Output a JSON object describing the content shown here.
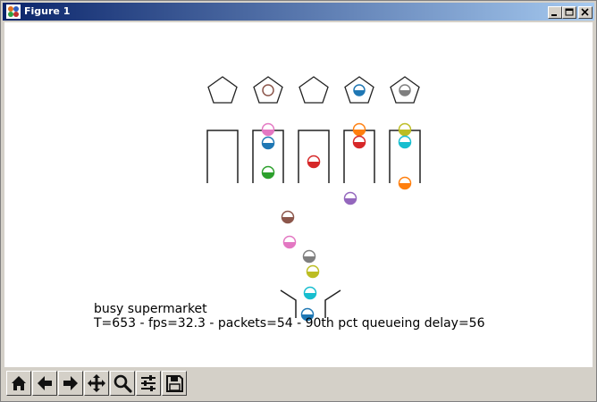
{
  "window": {
    "title": "Figure 1"
  },
  "figure": {
    "line1": "busy supermarket",
    "line2": "T=653 - fps=32.3 - packets=54 - 90th pct queueing delay=56"
  },
  "colors": {
    "blue": "#1f77b4",
    "orange": "#ff7f0e",
    "green": "#2ca02c",
    "red": "#d62728",
    "purple": "#9467bd",
    "brown": "#8c564b",
    "pink": "#e377c2",
    "gray": "#7f7f7f",
    "olive": "#bcbd22",
    "cyan": "#17becf"
  },
  "scene": {
    "servers": [
      {
        "name": "server-1",
        "holding": null
      },
      {
        "name": "server-2",
        "holding": "brown"
      },
      {
        "name": "server-3",
        "holding": null
      },
      {
        "name": "server-4",
        "holding": "blue"
      },
      {
        "name": "server-5",
        "holding": "gray"
      }
    ],
    "packets": [
      {
        "color": "pink",
        "where": "queue-2"
      },
      {
        "color": "blue",
        "where": "queue-2"
      },
      {
        "color": "green",
        "where": "queue-2"
      },
      {
        "color": "red",
        "where": "queue-3"
      },
      {
        "color": "orange",
        "where": "queue-4"
      },
      {
        "color": "red",
        "where": "queue-4"
      },
      {
        "color": "olive",
        "where": "queue-5"
      },
      {
        "color": "cyan",
        "where": "queue-5"
      },
      {
        "color": "orange",
        "where": "queue-5"
      },
      {
        "color": "purple",
        "where": "in-flight"
      },
      {
        "color": "brown",
        "where": "in-flight"
      },
      {
        "color": "pink",
        "where": "in-flight"
      },
      {
        "color": "gray",
        "where": "in-flight"
      },
      {
        "color": "olive",
        "where": "in-flight"
      },
      {
        "color": "cyan",
        "where": "in-flight"
      },
      {
        "color": "blue",
        "where": "entrance"
      }
    ]
  },
  "toolbar": {
    "buttons": [
      {
        "name": "home-button",
        "icon": "home-icon"
      },
      {
        "name": "back-button",
        "icon": "arrow-left-icon"
      },
      {
        "name": "forward-button",
        "icon": "arrow-right-icon"
      },
      {
        "name": "pan-button",
        "icon": "move-icon"
      },
      {
        "name": "zoom-button",
        "icon": "magnifier-icon"
      },
      {
        "name": "configure-subplots-button",
        "icon": "sliders-icon"
      },
      {
        "name": "save-button",
        "icon": "floppy-disk-icon"
      }
    ]
  }
}
